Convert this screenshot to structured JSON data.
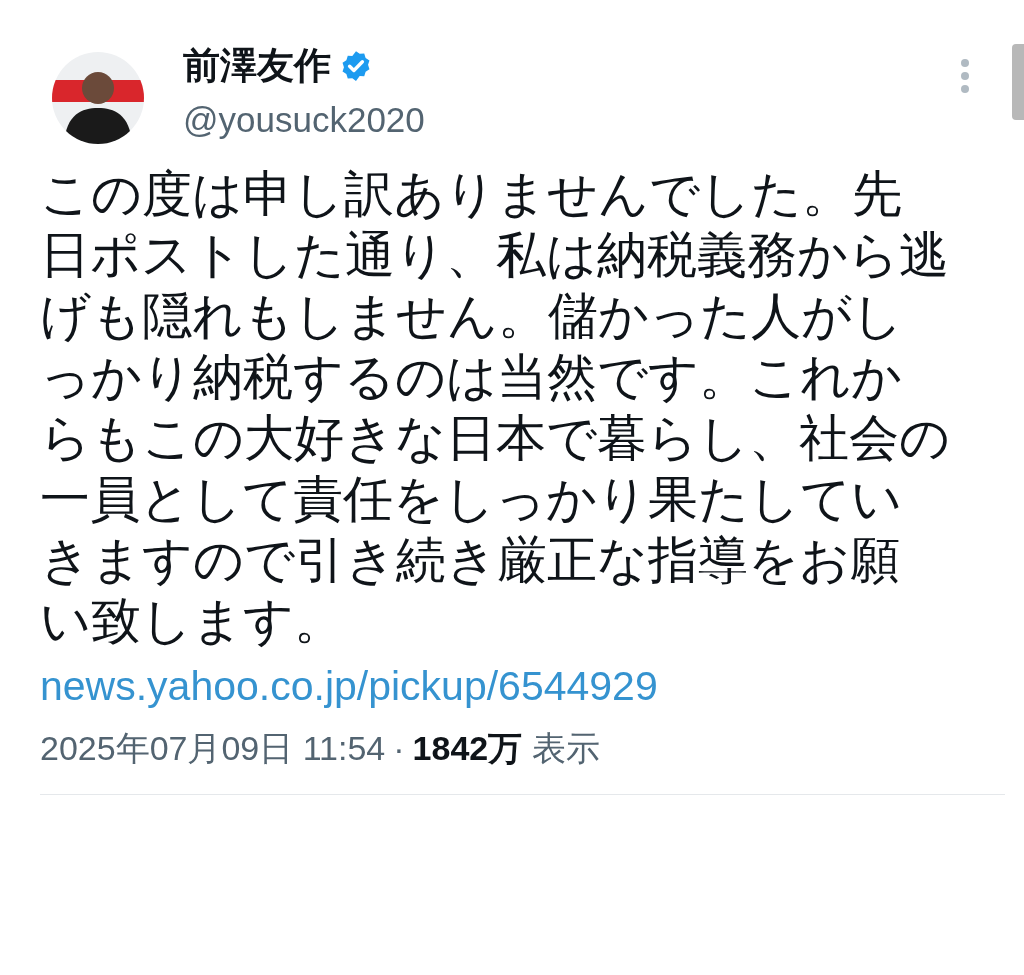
{
  "author": {
    "name": "前澤友作",
    "verified": true,
    "handle": "@yousuck2020"
  },
  "post": {
    "text": "この度は申し訳ありませんでした。先日ポストした通り、私は納税義務から逃げも隠れもしません。儲かった人がしっかり納税するのは当然です。これからもこの大好きな日本で暮らし、社会の一員として責任をしっかり果たしていきますので引き続き厳正な指導をお願い致します。",
    "link": "news.yahoo.co.jp/pickup/6544929"
  },
  "meta": {
    "timestamp": "2025年07月09日 11:54",
    "separator": "·",
    "views_count": "1842万",
    "views_label": "表示"
  }
}
